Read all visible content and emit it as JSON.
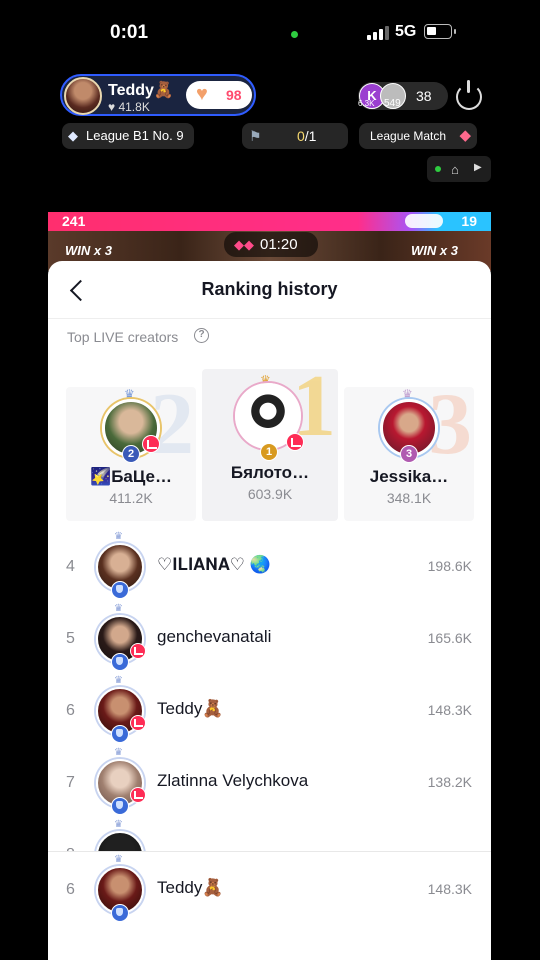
{
  "status_bar": {
    "time": "0:01",
    "network": "5G"
  },
  "host": {
    "name": "Teddy🧸",
    "likes": "♥ 41.8K",
    "follow_count": "98"
  },
  "viewers": {
    "avatar_1": "K",
    "avatar_1_sub": "6.3K",
    "avatar_2_sub": "549",
    "count": "38"
  },
  "league": {
    "label": "League B1 No. 9"
  },
  "score": {
    "current": "0",
    "total": "/1"
  },
  "match": {
    "label": "League Match"
  },
  "battle": {
    "left_score": "241",
    "right_score": "19",
    "win_left": "WIN x 3",
    "win_right": "WIN x 3",
    "timer": "01:20",
    "progress_fraction": 0.81
  },
  "sheet": {
    "title": "Ranking history",
    "section_label": "Top LIVE creators",
    "info_icon": "?"
  },
  "podium": [
    {
      "rank": "2",
      "name": "🌠БаЦе…",
      "score": "411.2K"
    },
    {
      "rank": "1",
      "name": "Бялото…",
      "score": "603.9K"
    },
    {
      "rank": "3",
      "name": "Jessika…",
      "score": "348.1K"
    }
  ],
  "ranking": [
    {
      "rank": "4",
      "name": "♡𝐈𝐋𝐈𝐀𝐍𝐀♡ 🌏",
      "score": "198.6K"
    },
    {
      "rank": "5",
      "name": "genchevanatali",
      "score": "165.6K"
    },
    {
      "rank": "6",
      "name": "Teddy🧸",
      "score": "148.3K"
    },
    {
      "rank": "7",
      "name": "Zlatinna Velychkova",
      "score": "138.2K"
    },
    {
      "rank": "8",
      "name": "",
      "score": ""
    }
  ],
  "self_row": {
    "rank": "6",
    "name": "Teddy🧸",
    "score": "148.3K"
  },
  "colors": {
    "accent_pink": "#fe2c55",
    "battle_blue": "#2ac3ff",
    "host_border": "#2f5cff"
  }
}
